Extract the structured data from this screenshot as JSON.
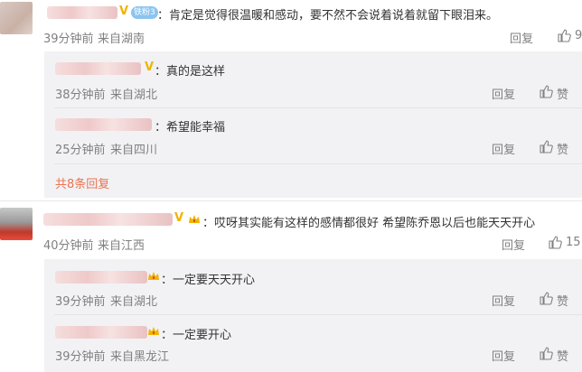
{
  "comments": [
    {
      "text": "：肯定是觉得很温暖和感动，要不然不会说着说着就留下眼泪来。",
      "time": "39分钟前",
      "location": "来自湖南",
      "reply_label": "回复",
      "like_count": "9",
      "fan_badge": "铁粉3",
      "replies": [
        {
          "text": "：真的是这样",
          "time": "38分钟前",
          "location": "来自湖北",
          "reply_label": "回复",
          "like_label": "赞"
        },
        {
          "text": "：希望能幸福",
          "time": "25分钟前",
          "location": "来自四川",
          "reply_label": "回复",
          "like_label": "赞"
        }
      ],
      "more_replies": "共8条回复"
    },
    {
      "text": "：哎呀其实能有这样的感情都很好 希望陈乔恩以后也能天天开心",
      "time": "40分钟前",
      "location": "来自江西",
      "reply_label": "回复",
      "like_count": "15",
      "replies": [
        {
          "text": "：一定要天天开心",
          "time": "39分钟前",
          "location": "来自湖北",
          "reply_label": "回复",
          "like_label": "赞"
        },
        {
          "text": "：一定要开心",
          "time": "39分钟前",
          "location": "来自黑龙江",
          "reply_label": "回复",
          "like_label": "赞"
        }
      ]
    }
  ],
  "colors": {
    "reply_bg": "#f2f2f5",
    "meta_gray": "#808080",
    "link_orange": "#eb7350",
    "vip_gold": "#f0b400",
    "fan_badge_blue": "#8cc4f0"
  },
  "icons": {
    "like": "thumbs-up-icon",
    "vip": "vip-v-icon",
    "crown": "crown-icon"
  }
}
